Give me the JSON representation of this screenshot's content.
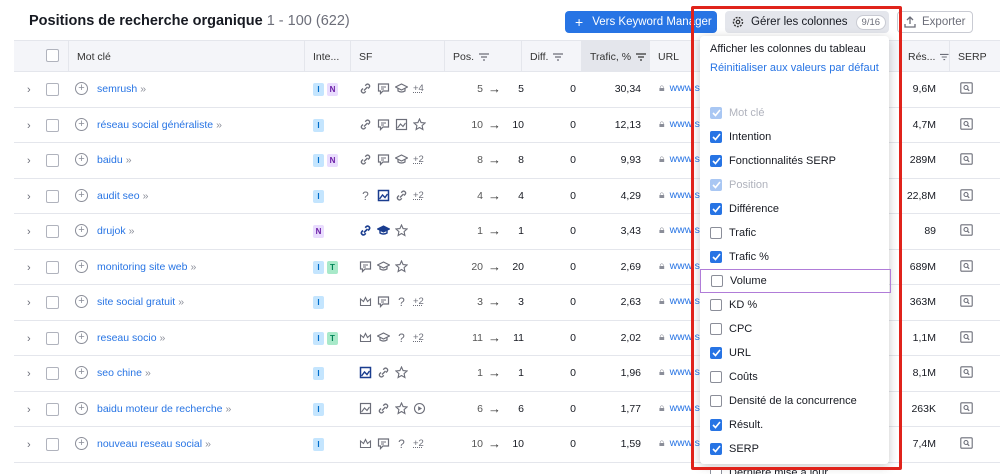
{
  "header": {
    "title": "Positions de recherche organique",
    "range": "1 - 100 (622)",
    "kw_button": "Vers Keyword Manager",
    "columns_button": "Gérer les colonnes",
    "columns_count": "9/16",
    "export_button": "Exporter"
  },
  "columns": {
    "keyword": "Mot clé",
    "intent": "Inte...",
    "sf": "SF",
    "pos": "Pos.",
    "diff": "Diff.",
    "traffic": "Trafic, %",
    "url": "URL",
    "results": "Rés...",
    "serp": "SERP"
  },
  "rows": [
    {
      "keyword": "semrush",
      "intents": [
        "I",
        "N"
      ],
      "sf": [
        "link",
        "review",
        "edu"
      ],
      "sf_more": "+4",
      "pos_prev": "5",
      "pos": "5",
      "diff": "0",
      "traffic": "30,34",
      "url": "www.s",
      "results": "9,6M"
    },
    {
      "keyword": "réseau social généraliste",
      "intents": [
        "I"
      ],
      "sf": [
        "link",
        "review",
        "image",
        "star"
      ],
      "sf_more": "",
      "pos_prev": "10",
      "pos": "10",
      "diff": "0",
      "traffic": "12,13",
      "url": "www.s",
      "results": "4,7M"
    },
    {
      "keyword": "baidu",
      "intents": [
        "I",
        "N"
      ],
      "sf": [
        "link",
        "review",
        "edu"
      ],
      "sf_more": "+2",
      "pos_prev": "8",
      "pos": "8",
      "diff": "0",
      "traffic": "9,93",
      "url": "www.s",
      "results": "289M"
    },
    {
      "keyword": "audit seo",
      "intents": [
        "I"
      ],
      "sf": [
        "question",
        "image-blue",
        "link"
      ],
      "sf_more": "+2",
      "pos_prev": "4",
      "pos": "4",
      "diff": "0",
      "traffic": "4,29",
      "url": "www.s",
      "results": "22,8M"
    },
    {
      "keyword": "drujok",
      "intents": [
        "N"
      ],
      "sf": [
        "link-blue",
        "edu-blue",
        "star"
      ],
      "sf_more": "",
      "pos_prev": "1",
      "pos": "1",
      "diff": "0",
      "traffic": "3,43",
      "url": "www.s",
      "results": "89"
    },
    {
      "keyword": "monitoring site web",
      "intents": [
        "I",
        "T"
      ],
      "sf": [
        "review",
        "edu",
        "star"
      ],
      "sf_more": "",
      "pos_prev": "20",
      "pos": "20",
      "diff": "0",
      "traffic": "2,69",
      "url": "www.s",
      "results": "689M"
    },
    {
      "keyword": "site social gratuit",
      "intents": [
        "I"
      ],
      "sf": [
        "crown",
        "review",
        "question"
      ],
      "sf_more": "+2",
      "pos_prev": "3",
      "pos": "3",
      "diff": "0",
      "traffic": "2,63",
      "url": "www.s",
      "results": "363M"
    },
    {
      "keyword": "reseau socio",
      "intents": [
        "I",
        "T"
      ],
      "sf": [
        "crown",
        "edu",
        "question"
      ],
      "sf_more": "+2",
      "pos_prev": "11",
      "pos": "11",
      "diff": "0",
      "traffic": "2,02",
      "url": "www.s",
      "results": "1,1M"
    },
    {
      "keyword": "seo chine",
      "intents": [
        "I"
      ],
      "sf": [
        "image-blue",
        "link",
        "star"
      ],
      "sf_more": "",
      "pos_prev": "1",
      "pos": "1",
      "diff": "0",
      "traffic": "1,96",
      "url": "www.s",
      "results": "8,1M"
    },
    {
      "keyword": "baidu moteur de recherche",
      "intents": [
        "I"
      ],
      "sf": [
        "image",
        "link",
        "star",
        "video"
      ],
      "sf_more": "",
      "pos_prev": "6",
      "pos": "6",
      "diff": "0",
      "traffic": "1,77",
      "url": "www.s",
      "results": "263K"
    },
    {
      "keyword": "nouveau reseau social",
      "intents": [
        "I"
      ],
      "sf": [
        "crown",
        "review",
        "question"
      ],
      "sf_more": "+2",
      "pos_prev": "10",
      "pos": "10",
      "diff": "0",
      "traffic": "1,59",
      "url": "www.s",
      "results": "7,4M"
    }
  ],
  "dropdown": {
    "title": "Afficher les colonnes du tableau",
    "reset": "Réinitialiser aux valeurs par défaut",
    "items": [
      {
        "label": "Mot clé",
        "checked": true,
        "disabled": true
      },
      {
        "label": "Intention",
        "checked": true,
        "disabled": false
      },
      {
        "label": "Fonctionnalités SERP",
        "checked": true,
        "disabled": false
      },
      {
        "label": "Position",
        "checked": true,
        "disabled": true
      },
      {
        "label": "Différence",
        "checked": true,
        "disabled": false
      },
      {
        "label": "Trafic",
        "checked": false,
        "disabled": false
      },
      {
        "label": "Trafic %",
        "checked": true,
        "disabled": false
      },
      {
        "label": "Volume",
        "checked": false,
        "disabled": false
      },
      {
        "label": "KD %",
        "checked": false,
        "disabled": false
      },
      {
        "label": "CPC",
        "checked": false,
        "disabled": false
      },
      {
        "label": "URL",
        "checked": true,
        "disabled": false
      },
      {
        "label": "Coûts",
        "checked": false,
        "disabled": false
      },
      {
        "label": "Densité de la concurrence",
        "checked": false,
        "disabled": false
      },
      {
        "label": "Résult.",
        "checked": true,
        "disabled": false
      },
      {
        "label": "SERP",
        "checked": true,
        "disabled": false
      },
      {
        "label": "Dernière mise à jour",
        "checked": false,
        "disabled": false
      }
    ]
  },
  "colors": {
    "accent": "#2774e4",
    "highlight": "#e0231b",
    "hover_outline": "#b07cd8"
  }
}
